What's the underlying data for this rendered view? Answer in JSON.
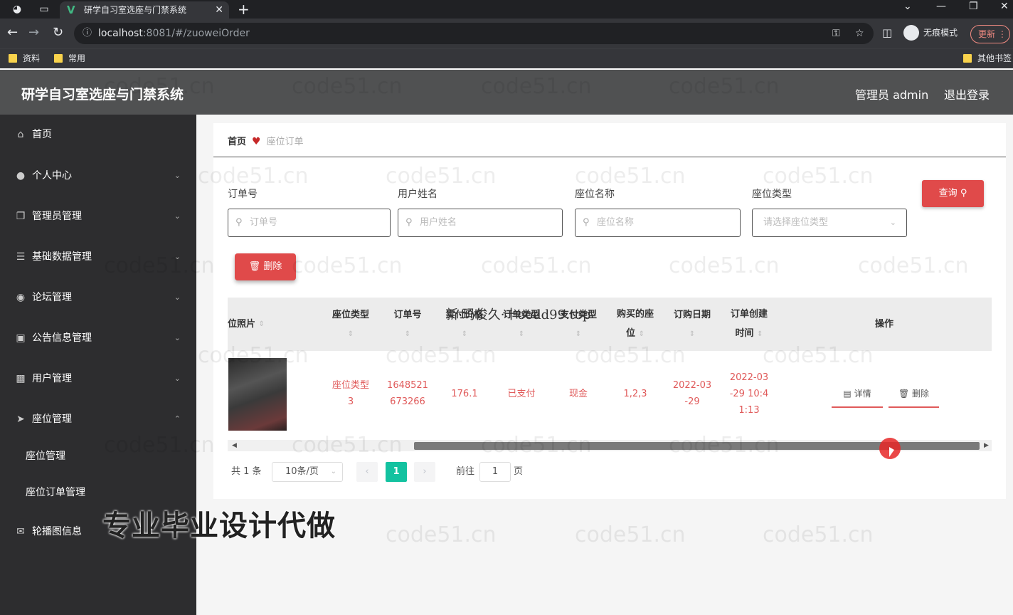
{
  "browser": {
    "tab_title": "研学自习室选座与门禁系统",
    "url_host": "localhost",
    "url_path": ":8081/#/zuoweiOrder",
    "incognito_label": "无痕模式",
    "update_label": "更新",
    "bookmarks": [
      "资料",
      "常用"
    ],
    "other_bookmarks": "其他书签"
  },
  "header": {
    "title": "研学自习室选座与门禁系统",
    "admin_label": "管理员 admin",
    "logout_label": "退出登录"
  },
  "sidebar": {
    "items": [
      {
        "label": "首页",
        "icon": "home-icon"
      },
      {
        "label": "个人中心",
        "icon": "user-icon"
      },
      {
        "label": "管理员管理",
        "icon": "copy-icon"
      },
      {
        "label": "基础数据管理",
        "icon": "list-icon"
      },
      {
        "label": "论坛管理",
        "icon": "location-icon"
      },
      {
        "label": "公告信息管理",
        "icon": "notice-icon"
      },
      {
        "label": "用户管理",
        "icon": "chart-icon"
      },
      {
        "label": "座位管理",
        "icon": "send-icon"
      },
      {
        "label": "轮播图信息",
        "icon": "mail-icon"
      }
    ],
    "sub_items": [
      "座位管理",
      "座位订单管理"
    ]
  },
  "breadcrumb": {
    "home": "首页",
    "current": "座位订单"
  },
  "search": {
    "order_no_label": "订单号",
    "order_no_placeholder": "订单号",
    "user_name_label": "用户姓名",
    "user_name_placeholder": "用户姓名",
    "seat_name_label": "座位名称",
    "seat_name_placeholder": "座位名称",
    "seat_type_label": "座位类型",
    "seat_type_placeholder": "请选择座位类型",
    "query_label": "查询"
  },
  "toolbar": {
    "delete_label": "删除"
  },
  "table": {
    "headers": {
      "photo": "位照片",
      "seat_type": "座位类型",
      "order_no": "订单号",
      "price": "实付价格",
      "status": "订单类型",
      "pay_type": "支付类型",
      "seats_1": "购买的座",
      "seats_2": "位",
      "date": "订购日期",
      "created_1": "订单创建",
      "created_2": "时间",
      "actions": "操作"
    },
    "rows": [
      {
        "seat_type_1": "座位类型",
        "seat_type_2": "3",
        "order_no_1": "1648521",
        "order_no_2": "673266",
        "price": "176.1",
        "status": "已支付",
        "pay_type": "现金",
        "seats": "1,2,3",
        "date_1": "2022-03",
        "date_2": "-29",
        "created_1": "2022-03",
        "created_2": "-29 10:4",
        "created_3": "1:13",
        "detail_label": "详情",
        "delete_label": "删除"
      }
    ]
  },
  "pagination": {
    "total": "共 1 条",
    "page_size": "10条/页",
    "current_page": "1",
    "goto_label": "前往",
    "goto_value": "1",
    "page_suffix": "页"
  },
  "overlays": {
    "top_text": "新·玛俊久·十oodd99.top",
    "big_text": "专业毕业设计代做",
    "watermark": "code51.cn"
  }
}
